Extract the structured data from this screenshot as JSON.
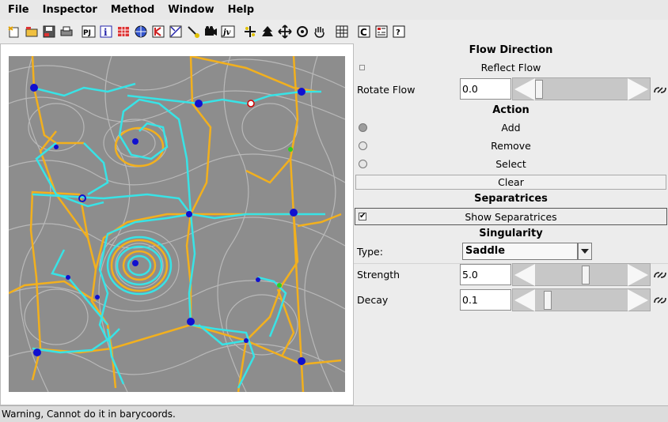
{
  "menubar": {
    "items": [
      "File",
      "Inspector",
      "Method",
      "Window",
      "Help"
    ]
  },
  "toolbar": {
    "buttons": [
      "new-icon",
      "open-icon",
      "save-icon",
      "print-icon",
      "pj-icon",
      "info-icon",
      "grid-icon",
      "sphere-icon",
      "kb-icon",
      "transform-icon",
      "brush-icon",
      "camera-icon",
      "js-icon",
      "axes-icon",
      "tree-icon",
      "move-icon",
      "rotate-icon",
      "hand-icon",
      "table-icon",
      "c-icon",
      "layers-icon",
      "help-icon"
    ],
    "labels": {
      "pj": "PJ",
      "js": "jv",
      "c": "C"
    }
  },
  "panel": {
    "flow_direction": {
      "title": "Flow Direction",
      "reflect_label": "Reflect Flow",
      "rotate_label": "Rotate Flow",
      "rotate_value": "0.0",
      "rotate_slider": 0.0
    },
    "action": {
      "title": "Action",
      "options": [
        "Add",
        "Remove",
        "Select"
      ],
      "selected": "Add",
      "clear_label": "Clear"
    },
    "separatrices": {
      "title": "Separatrices",
      "show_label": "Show Separatrices",
      "checked": true
    },
    "singularity": {
      "title": "Singularity",
      "type_label": "Type:",
      "type_value": "Saddle",
      "strength_label": "Strength",
      "strength_value": "5.0",
      "strength_slider": 0.55,
      "decay_label": "Decay",
      "decay_value": "0.1",
      "decay_slider": 0.1
    }
  },
  "status": {
    "message": "Warning, Cannot do it in barycoords."
  },
  "colors": {
    "separatrix_orange": "#f2b01e",
    "separatrix_cyan": "#38e3e6",
    "singularity_blue": "#1010d0",
    "singularity_green": "#30d020"
  }
}
